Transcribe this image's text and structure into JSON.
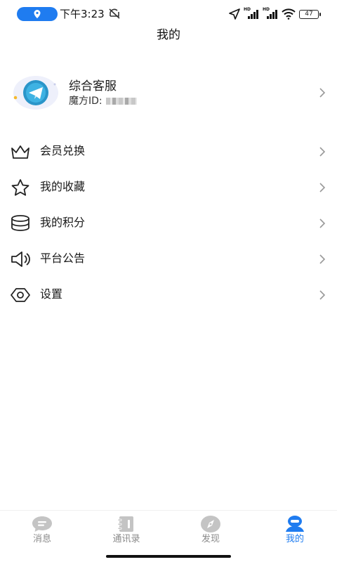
{
  "status_bar": {
    "time": "下午3:23",
    "battery": "47",
    "icons": [
      "location-pill-icon",
      "mute-icon",
      "navigation-arrow-icon",
      "hd-signal-icon",
      "hd-signal-icon",
      "wifi-icon",
      "battery-icon"
    ],
    "accent_color": "#1f7cf0"
  },
  "header": {
    "title": "我的"
  },
  "profile": {
    "name": "综合客服",
    "id_label": "魔方ID:",
    "avatar_icon": "paper-plane-icon"
  },
  "menu": [
    {
      "label": "会员兑换",
      "icon": "crown-icon"
    },
    {
      "label": "我的收藏",
      "icon": "star-icon"
    },
    {
      "label": "我的积分",
      "icon": "coin-stack-icon"
    },
    {
      "label": "平台公告",
      "icon": "speaker-icon"
    },
    {
      "label": "设置",
      "icon": "eye-icon"
    }
  ],
  "bottom_nav": {
    "tabs": [
      {
        "label": "消息",
        "icon": "chat-bubble-icon"
      },
      {
        "label": "通讯录",
        "icon": "contacts-book-icon"
      },
      {
        "label": "发现",
        "icon": "compass-icon"
      },
      {
        "label": "我的",
        "icon": "user-icon"
      }
    ],
    "active_tab": "我的",
    "active_color": "#1f7cf0",
    "inactive_color": "#c4c4c4"
  }
}
